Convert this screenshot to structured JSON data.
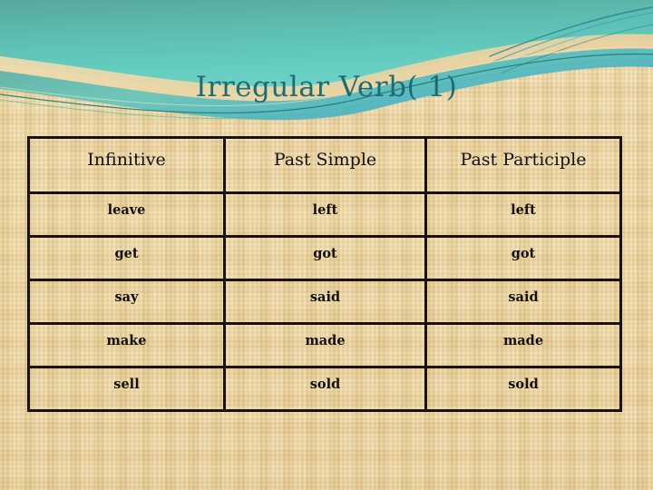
{
  "slide": {
    "title": "Irregular Verb( 1)",
    "background_color": "#edd6a4",
    "title_color": "#1d6c74",
    "accent_color": "#3fb8ad",
    "banner_teal_dark": "#4f9f97",
    "banner_teal_light": "#6ccfc2",
    "border_color": "#19120a"
  },
  "table": {
    "headers": [
      "Infinitive",
      "Past Simple",
      "Past Participle"
    ],
    "rows": [
      {
        "infinitive": "leave",
        "past_simple": "left",
        "past_participle": "left"
      },
      {
        "infinitive": "get",
        "past_simple": "got",
        "past_participle": "got"
      },
      {
        "infinitive": "say",
        "past_simple": "said",
        "past_participle": "said"
      },
      {
        "infinitive": "make",
        "past_simple": "made",
        "past_participle": "made"
      },
      {
        "infinitive": "sell",
        "past_simple": "sold",
        "past_participle": "sold"
      }
    ]
  }
}
